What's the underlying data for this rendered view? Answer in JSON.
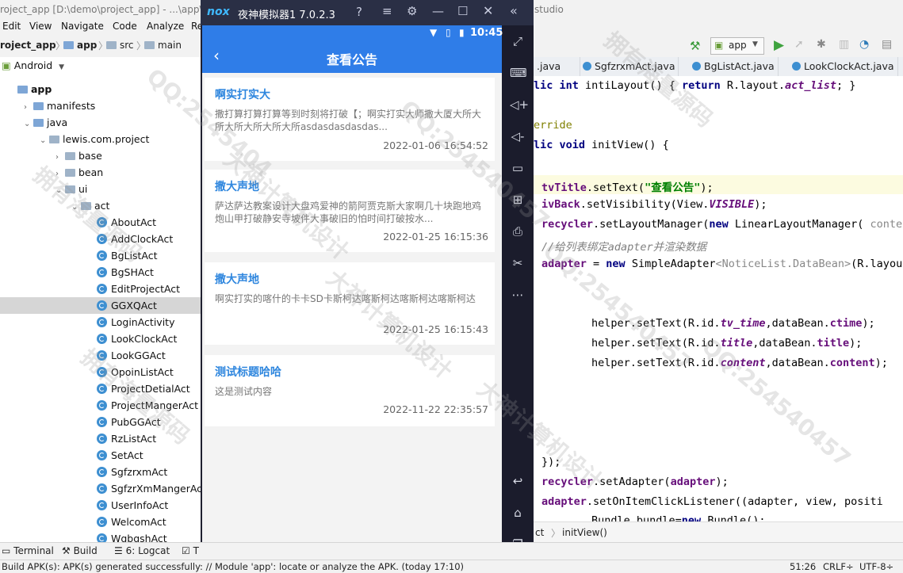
{
  "ide": {
    "title": "roject_app [D:\\demo\\project_app] - ...\\app\\",
    "title_right": "studio",
    "menu": [
      "Edit",
      "View",
      "Navigate",
      "Code",
      "Analyze",
      "Re"
    ],
    "breadcrumbs": [
      "roject_app",
      "app",
      "src",
      "main"
    ],
    "run_config": "app",
    "tree_mode": "Android",
    "tree": [
      {
        "label": "app",
        "depth": 0,
        "kind": "module",
        "arrow": ""
      },
      {
        "label": "manifests",
        "depth": 1,
        "kind": "folder",
        "arrow": "▶"
      },
      {
        "label": "java",
        "depth": 1,
        "kind": "folder",
        "arrow": "▼"
      },
      {
        "label": "lewis.com.project",
        "depth": 2,
        "kind": "folder",
        "arrow": "▼"
      },
      {
        "label": "base",
        "depth": 3,
        "kind": "folder",
        "arrow": "▶"
      },
      {
        "label": "bean",
        "depth": 3,
        "kind": "folder",
        "arrow": "▶"
      },
      {
        "label": "ui",
        "depth": 3,
        "kind": "folder",
        "arrow": "▼"
      },
      {
        "label": "act",
        "depth": 4,
        "kind": "folder",
        "arrow": "▼"
      },
      {
        "label": "AboutAct",
        "depth": 5,
        "kind": "class",
        "arrow": ""
      },
      {
        "label": "AddClockAct",
        "depth": 5,
        "kind": "class",
        "arrow": ""
      },
      {
        "label": "BgListAct",
        "depth": 5,
        "kind": "class",
        "arrow": ""
      },
      {
        "label": "BgSHAct",
        "depth": 5,
        "kind": "class",
        "arrow": ""
      },
      {
        "label": "EditProjectAct",
        "depth": 5,
        "kind": "class",
        "arrow": ""
      },
      {
        "label": "GGXQAct",
        "depth": 5,
        "kind": "class",
        "arrow": "",
        "selected": true
      },
      {
        "label": "LoginActivity",
        "depth": 5,
        "kind": "class",
        "arrow": ""
      },
      {
        "label": "LookClockAct",
        "depth": 5,
        "kind": "class",
        "arrow": ""
      },
      {
        "label": "LookGGAct",
        "depth": 5,
        "kind": "class",
        "arrow": ""
      },
      {
        "label": "OpoinListAct",
        "depth": 5,
        "kind": "class",
        "arrow": ""
      },
      {
        "label": "ProjectDetialAct",
        "depth": 5,
        "kind": "class",
        "arrow": ""
      },
      {
        "label": "ProjectMangerAct",
        "depth": 5,
        "kind": "class",
        "arrow": ""
      },
      {
        "label": "PubGGAct",
        "depth": 5,
        "kind": "class",
        "arrow": ""
      },
      {
        "label": "RzListAct",
        "depth": 5,
        "kind": "class",
        "arrow": ""
      },
      {
        "label": "SetAct",
        "depth": 5,
        "kind": "class",
        "arrow": ""
      },
      {
        "label": "SgfzrxmAct",
        "depth": 5,
        "kind": "class",
        "arrow": ""
      },
      {
        "label": "SgfzrXmMangerAct",
        "depth": 5,
        "kind": "class",
        "arrow": ""
      },
      {
        "label": "UserInfoAct",
        "depth": 5,
        "kind": "class",
        "arrow": ""
      },
      {
        "label": "WelcomAct",
        "depth": 5,
        "kind": "class",
        "arrow": ""
      },
      {
        "label": "WgbgshAct",
        "depth": 5,
        "kind": "class",
        "arrow": ""
      }
    ],
    "tabs": [
      ".java",
      "SgfzrxmAct.java",
      "BgListAct.java",
      "LookClockAct.java"
    ],
    "code_crumbs": [
      "ct",
      "initView()"
    ],
    "tool_windows": [
      "Terminal",
      "Build",
      "6: Logcat",
      "T"
    ],
    "status_message": "Build APK(s): APK(s) generated successfully: // Module 'app': locate or analyze the APK. (today 17:10)",
    "status_pos": "51:26",
    "status_crlf": "CRLF÷",
    "status_enc": "UTF-8÷"
  },
  "emulator": {
    "brand": "nox",
    "title": "夜神模拟器1 7.0.2.3",
    "time": "10:45",
    "page_title": "查看公告",
    "notices": [
      {
        "title": "啊实打实大",
        "content": "撒打算打算打算等到时刻将打破【；啊实打实大师撒大厦大所大所大所大所大所大所asdasdasdasdas...",
        "time": "2022-01-06 16:54:52"
      },
      {
        "title": "撒大声地",
        "content": "萨达萨达教案设计大盘鸡爱神的箭阿贾克斯大家啊几十块跑地鸡炮山甲打破静安寺坡件大事破旧的怕时间打破按水...",
        "time": "2022-01-25 16:15:36"
      },
      {
        "title": "撒大声地",
        "content": "啊实打实的喀什的卡卡SD卡斯柯达喀斯柯达喀斯柯达喀斯柯达",
        "time": "2022-01-25 16:15:43"
      },
      {
        "title": "测试标题哈哈",
        "content": "这是测试内容",
        "time": "2022-11-22 22:35:57"
      }
    ]
  },
  "code": {
    "l1": {
      "kw": "lic int",
      "fn": " intiLayout() { ",
      "kw2": "return",
      "rest": " R.layout.",
      "field": "act_list",
      "end": "; }"
    },
    "l2": "erride",
    "l3": {
      "kw": "lic void",
      "rest": " initView() {"
    },
    "l4": {
      "field": "tvTitle",
      "mid": ".setText(",
      "str": "\"查看公告\"",
      "end": ");"
    },
    "l5": {
      "field": "ivBack",
      "mid": ".setVisibility(View.",
      "ital": "VISIBLE",
      "end": ");"
    },
    "l6": {
      "field": "recycler",
      "mid": ".setLayoutManager(",
      "kw": "new",
      "rest": " LinearLayoutManager(",
      "hint": " conte"
    },
    "l7": {
      "cmt1": "//给列表绑定",
      "cmt2": "adapter",
      "cmt3": "并渲染数据"
    },
    "l8": {
      "field": "adapter",
      "mid": " = ",
      "kw": "new",
      "rest": " SimpleAdapter",
      "hint": "<NoticeList.DataBean>",
      "end": "(R.layou"
    },
    "l9": {
      "pre": "helper.setText(R.id.",
      "id": "tv_time",
      "mid": ",dataBean.",
      "f": "ctime",
      "end": ");"
    },
    "l10": {
      "pre": "helper.setText(R.id.",
      "id": "title",
      "mid": ",dataBean.",
      "f": "title",
      "end": ");"
    },
    "l11": {
      "pre": "helper.setText(R.id.",
      "id": "content",
      "mid": ",dataBean.",
      "f": "content",
      "end": ");"
    },
    "l12": "});",
    "l13": {
      "field": "recycler",
      "mid": ".setAdapter(",
      "f": "adapter",
      "end": ");"
    },
    "l14": {
      "field": "adapter",
      "mid": ".setOnItemClickListener((adapter, view, positi"
    },
    "l15": {
      "pre": "Bundle bundle=",
      "kw": "new",
      "rest": " Bundle();"
    }
  },
  "watermarks": [
    "QQ:2545404",
    "拥有海量源码",
    "大神计算机设计",
    "QQ:254540457",
    "拥有海量源码",
    "大神计算机设计",
    "QQ:254540457",
    "拥有海量源码",
    "大神计算机设计",
    "QQ:254540457"
  ]
}
